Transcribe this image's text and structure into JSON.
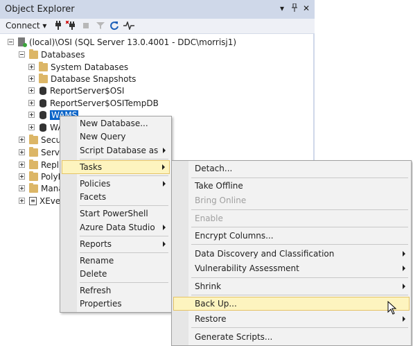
{
  "window": {
    "title": "Object Explorer",
    "controls": [
      "▾",
      "ᵖ",
      "✕"
    ]
  },
  "toolbar": {
    "connect_label": "Connect ▾"
  },
  "tree": {
    "server": "(local)\\OSI (SQL Server 13.0.4001 - DDC\\morrisj1)",
    "databases": "Databases",
    "system_databases": "System Databases",
    "database_snapshots": "Database Snapshots",
    "db1": "ReportServer$OSI",
    "db2": "ReportServer$OSITempDB",
    "db3": "WAMS",
    "db4": "WA",
    "security": "Secur",
    "server_objects": "Serve",
    "replication": "Replic",
    "polybase": "PolyB",
    "management": "Mana",
    "xevent": "XEver"
  },
  "context_menu": {
    "items": [
      "New Database...",
      "New Query",
      "Script Database as",
      "Tasks",
      "Policies",
      "Facets",
      "Start PowerShell",
      "Azure Data Studio",
      "Reports",
      "Rename",
      "Delete",
      "Refresh",
      "Properties"
    ]
  },
  "tasks_menu": {
    "items": [
      "Detach...",
      "Take Offline",
      "Bring Online",
      "Enable",
      "Encrypt Columns...",
      "Data Discovery and Classification",
      "Vulnerability Assessment",
      "Shrink",
      "Back Up...",
      "Restore",
      "Generate Scripts..."
    ]
  }
}
